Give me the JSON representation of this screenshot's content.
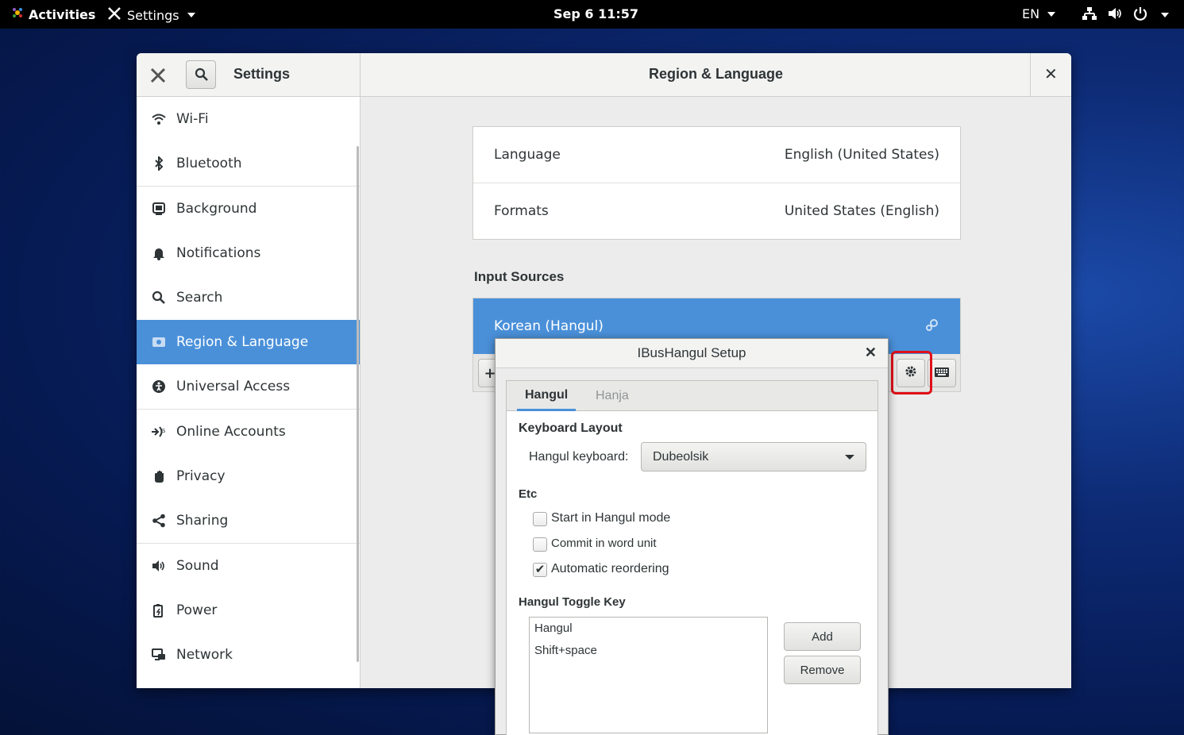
{
  "topbar": {
    "activities": "Activities",
    "app_menu": "Settings",
    "clock": "Sep 6  11:57",
    "lang": "EN"
  },
  "settings": {
    "header_title": "Settings",
    "panel_title": "Region & Language",
    "sidebar": [
      {
        "label": "Wi-Fi",
        "icon": "wifi-icon"
      },
      {
        "label": "Bluetooth",
        "icon": "bluetooth-icon"
      },
      {
        "label": "Background",
        "icon": "background-icon"
      },
      {
        "label": "Notifications",
        "icon": "bell-icon"
      },
      {
        "label": "Search",
        "icon": "search-icon"
      },
      {
        "label": "Region & Language",
        "icon": "region-icon"
      },
      {
        "label": "Universal Access",
        "icon": "accessibility-icon"
      },
      {
        "label": "Online Accounts",
        "icon": "online-accounts-icon"
      },
      {
        "label": "Privacy",
        "icon": "hand-icon"
      },
      {
        "label": "Sharing",
        "icon": "share-icon"
      },
      {
        "label": "Sound",
        "icon": "speaker-icon"
      },
      {
        "label": "Power",
        "icon": "power-icon"
      },
      {
        "label": "Network",
        "icon": "network-icon"
      }
    ],
    "language_label": "Language",
    "language_value": "English (United States)",
    "formats_label": "Formats",
    "formats_value": "United States (English)",
    "input_sources_heading": "Input Sources",
    "input_source": "Korean (Hangul)",
    "add_symbol": "+"
  },
  "dialog": {
    "title": "IBusHangul Setup",
    "tabs": [
      "Hangul",
      "Hanja"
    ],
    "keyboard_layout_heading": "Keyboard Layout",
    "hangul_keyboard_label": "Hangul keyboard:",
    "hangul_keyboard_value": "Dubeolsik",
    "etc_heading": "Etc",
    "options": [
      {
        "label": "Start in Hangul mode",
        "checked": false
      },
      {
        "label": "Commit in word unit",
        "checked": false
      },
      {
        "label": "Automatic reordering",
        "checked": true
      }
    ],
    "toggle_key_heading": "Hangul Toggle Key",
    "toggle_keys": [
      "Hangul",
      "Shift+space"
    ],
    "add_button": "Add",
    "remove_button": "Remove"
  },
  "colors": {
    "accent": "#4a90d9",
    "highlight_box": "#e0101a"
  }
}
